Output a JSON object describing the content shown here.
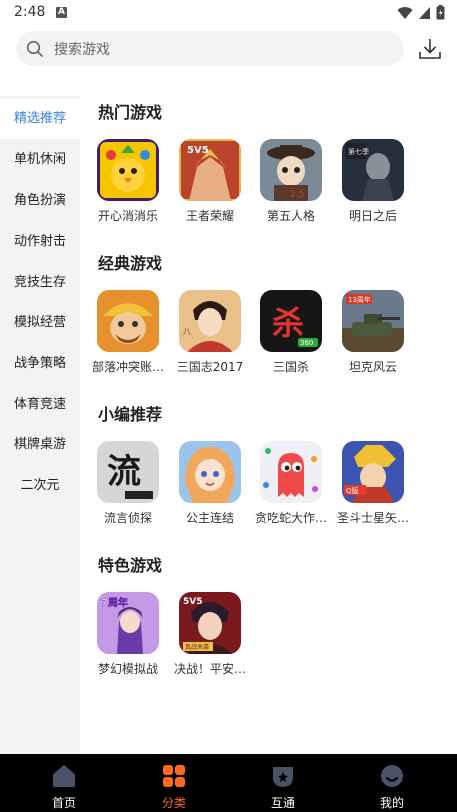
{
  "status_bar": {
    "time": "2:48",
    "notification_letter": "A"
  },
  "search": {
    "placeholder": "搜索游戏"
  },
  "sidebar": {
    "items": [
      {
        "label": "精选推荐",
        "active": true
      },
      {
        "label": "单机休闲"
      },
      {
        "label": "角色扮演"
      },
      {
        "label": "动作射击"
      },
      {
        "label": "竞技生存"
      },
      {
        "label": "模拟经营"
      },
      {
        "label": "战争策略"
      },
      {
        "label": "体育竞速"
      },
      {
        "label": "棋牌桌游"
      },
      {
        "label": "二次元"
      }
    ]
  },
  "sections": [
    {
      "title": "热门游戏",
      "games": [
        {
          "name": "开心消消乐",
          "icon": "chick-game-icon",
          "color": "#f5c400"
        },
        {
          "name": "王者荣耀",
          "icon": "hero-game-icon",
          "color": "#b9442b"
        },
        {
          "name": "第五人格",
          "icon": "doll-game-icon",
          "color": "#6b7c8a"
        },
        {
          "name": "明日之后",
          "icon": "survivor-game-icon",
          "color": "#2b3340"
        }
      ]
    },
    {
      "title": "经典游戏",
      "games": [
        {
          "name": "部落冲突账…",
          "icon": "barbarian-game-icon",
          "color": "#e08a2a"
        },
        {
          "name": "三国志2017",
          "icon": "general-game-icon",
          "color": "#d9a86a"
        },
        {
          "name": "三国杀",
          "icon": "kill-game-icon",
          "color": "#1a1a1a"
        },
        {
          "name": "坦克风云",
          "icon": "tank-game-icon",
          "color": "#5b6a4a"
        }
      ]
    },
    {
      "title": "小编推荐",
      "games": [
        {
          "name": "流言侦探",
          "icon": "calligraphy-game-icon",
          "color": "#d8d8d8"
        },
        {
          "name": "公主连结",
          "icon": "princess-game-icon",
          "color": "#f3b06c"
        },
        {
          "name": "贪吃蛇大作…",
          "icon": "snake-game-icon",
          "color": "#eeeef3"
        },
        {
          "name": "圣斗士星矢…",
          "icon": "saint-game-icon",
          "color": "#3a4fa8"
        }
      ]
    },
    {
      "title": "特色游戏",
      "games": [
        {
          "name": "梦幻模拟战",
          "icon": "fantasy-game-icon",
          "color": "#b07ad8"
        },
        {
          "name": "决战！平安…",
          "icon": "onmyoji-game-icon",
          "color": "#8a1e22"
        }
      ]
    }
  ],
  "bottom_nav": {
    "items": [
      {
        "label": "首页",
        "icon": "home-icon"
      },
      {
        "label": "分类",
        "icon": "category-icon",
        "active": true
      },
      {
        "label": "互通",
        "icon": "interop-icon"
      },
      {
        "label": "我的",
        "icon": "profile-icon"
      }
    ]
  },
  "colors": {
    "accent": "#3b7ee8",
    "nav_active": "#ff6a1a",
    "nav_bg": "#000000"
  }
}
